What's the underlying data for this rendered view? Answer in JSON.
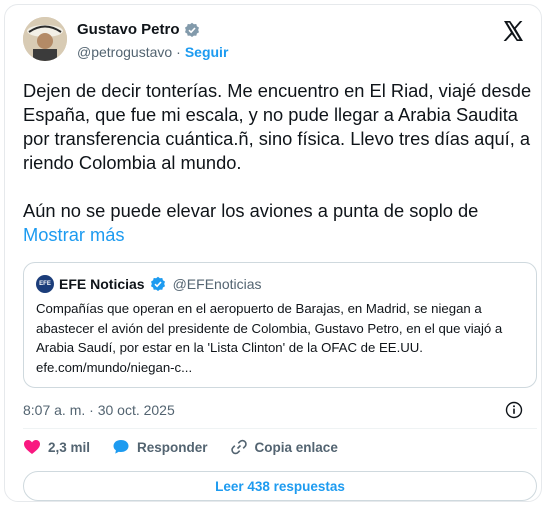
{
  "author": {
    "name": "Gustavo Petro",
    "handle": "@petrogustavo",
    "separator": "·",
    "follow_label": "Seguir"
  },
  "tweet": {
    "lines_p1": "Dejen de decir tonterías. Me encuentro en El Riad, viajé desde España, que fue mi escala, y no pude llegar a Arabia Saudita por transferencia cuántica.ñ, sino física. Llevo tres días aquí, a riendo Colombia al mundo.",
    "lines_p2": "Aún no se puede elevar los aviones a punta de soplo de",
    "show_more": "Mostrar más"
  },
  "quote": {
    "logo_text": "EFE",
    "name": "EFE Noticias",
    "handle": "@EFEnoticias",
    "text": "Compañías que operan en el aeropuerto de Barajas, en Madrid, se niegan a abastecer el avión del presidente de Colombia, Gustavo Petro, en el que viajó a Arabia Saudí, por estar en la 'Lista Clinton' de la OFAC de EE.UU. efe.com/mundo/niegan-c..."
  },
  "timestamp": "8:07 a. m. · 30 oct. 2025",
  "actions": {
    "likes": "2,3 mil",
    "reply": "Responder",
    "copy_link": "Copia enlace"
  },
  "read_replies": "Leer 438 respuestas",
  "colors": {
    "accent": "#1d9bf0",
    "like": "#f91880",
    "muted": "#536471"
  }
}
